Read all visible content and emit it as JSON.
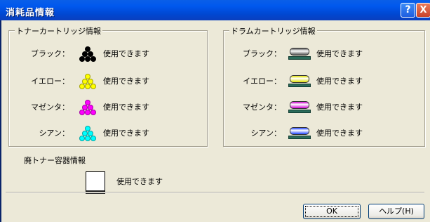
{
  "window": {
    "title": "消耗品情報",
    "help_button": "?",
    "close_button": "X"
  },
  "toner": {
    "group_title": "トナーカートリッジ情報",
    "items": [
      {
        "label": "ブラック：",
        "status": "使用できます",
        "color": "#000000"
      },
      {
        "label": "イエロー：",
        "status": "使用できます",
        "color": "#ffff00"
      },
      {
        "label": "マゼンタ：",
        "status": "使用できます",
        "color": "#ff00ff"
      },
      {
        "label": "シアン：",
        "status": "使用できます",
        "color": "#00ffff"
      }
    ]
  },
  "drum": {
    "group_title": "ドラムカートリッジ情報",
    "items": [
      {
        "label": "ブラック：",
        "status": "使用できます",
        "color": "#555555"
      },
      {
        "label": "イエロー：",
        "status": "使用できます",
        "color": "#e0e000"
      },
      {
        "label": "マゼンタ：",
        "status": "使用できます",
        "color": "#d000d0"
      },
      {
        "label": "シアン：",
        "status": "使用できます",
        "color": "#1e44ff"
      }
    ]
  },
  "waste": {
    "title": "廃トナー容器情報",
    "status": "使用できます"
  },
  "buttons": {
    "ok": "OK",
    "help": "ヘルプ(H)"
  }
}
